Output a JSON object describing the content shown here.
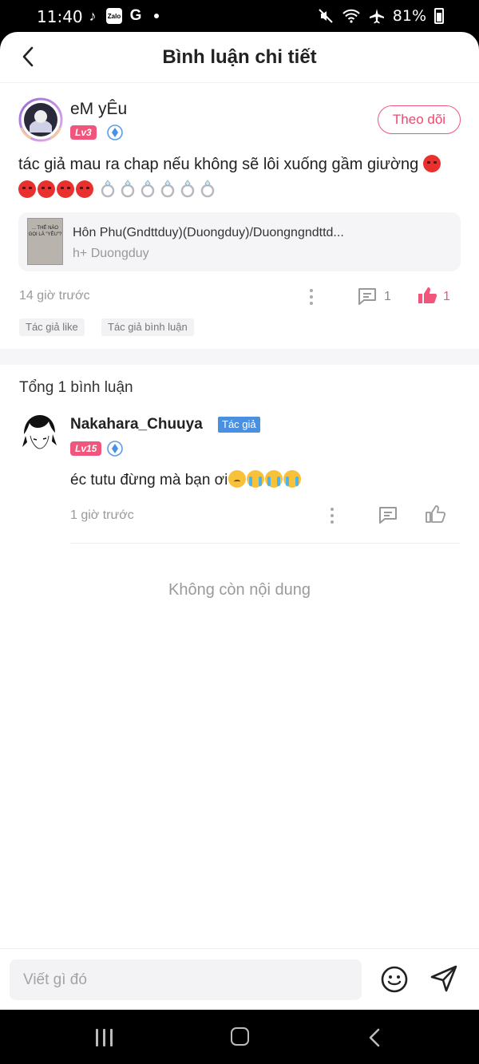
{
  "status_bar": {
    "time": "11:40",
    "app_icons": [
      "tiktok-icon",
      "zalo-icon",
      "grammarly-icon"
    ],
    "zalo_label": "Zalo",
    "grammarly_label": "G",
    "battery": "81%"
  },
  "header": {
    "title": "Bình luận chi tiết"
  },
  "main_comment": {
    "username": "eM yÊu",
    "level": "Lv3",
    "follow_label": "Theo dõi",
    "text": "tác giả mau ra chap nếu không sẽ lôi xuống gầm giường",
    "emoji_sequence": [
      "angry",
      "angry",
      "angry",
      "angry",
      "angry",
      "ring",
      "ring",
      "ring",
      "ring",
      "ring",
      "ring"
    ],
    "book": {
      "title": "Hôn Phu(Gndttduy)(Duongduy)/Duongngndttd...",
      "author": "h+ Duongduy",
      "cover_text": "... THẾ NÀO GỌI LÀ \"YÊU\"?"
    },
    "time": "14 giờ trước",
    "comment_count": "1",
    "like_count": "1",
    "tags": [
      "Tác giả like",
      "Tác giả bình luận"
    ]
  },
  "replies_section": {
    "total": "Tổng 1 bình luận"
  },
  "reply": {
    "username": "Nakahara_Chuuya",
    "author_badge": "Tác giả",
    "level": "Lv15",
    "text": "éc tutu đừng mà bạn ơi",
    "time": "1 giờ trước"
  },
  "footer_text": "Không còn nội dung",
  "input": {
    "placeholder": "Viết gì đó"
  },
  "colors": {
    "accent_pink": "#f0567b",
    "author_blue": "#4a90e2",
    "muted": "#999999"
  }
}
